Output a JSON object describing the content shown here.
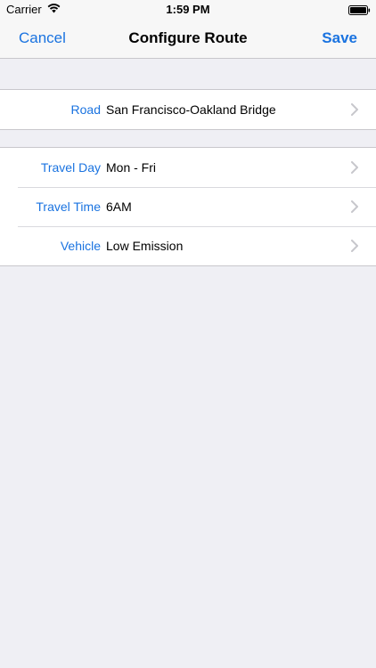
{
  "status_bar": {
    "carrier": "Carrier",
    "time": "1:59 PM",
    "wifi_icon": "wifi-icon",
    "battery_icon": "battery-icon"
  },
  "nav": {
    "cancel_label": "Cancel",
    "title": "Configure Route",
    "save_label": "Save"
  },
  "road": {
    "label": "Road",
    "value": "San Francisco-Oakland Bridge"
  },
  "settings": [
    {
      "label": "Travel Day",
      "value": "Mon - Fri"
    },
    {
      "label": "Travel Time",
      "value": "6AM"
    },
    {
      "label": "Vehicle",
      "value": "Low Emission"
    }
  ],
  "colors": {
    "accent": "#1a73e0",
    "background": "#efeff4",
    "cell": "#ffffff",
    "separator": "#c8c7cc",
    "chevron": "#c7c7cc"
  },
  "chevron_icon": "chevron-right-icon"
}
